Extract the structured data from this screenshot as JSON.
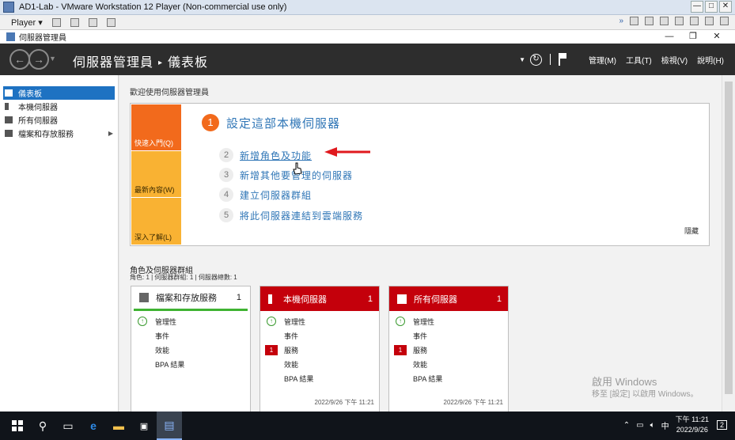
{
  "vmware": {
    "title": "AD1-Lab - VMware Workstation 12 Player (Non-commercial use only)",
    "player_menu": "Player ▾",
    "controls": [
      "—",
      "□",
      "✕"
    ]
  },
  "window": {
    "title": "伺服器管理員",
    "controls": [
      "—",
      "❐",
      "✕"
    ]
  },
  "header": {
    "breadcrumb_root": "伺服器管理員",
    "breadcrumb_sep": "▸",
    "breadcrumb_page": "儀表板",
    "menus": [
      "管理(M)",
      "工具(T)",
      "檢視(V)",
      "說明(H)"
    ]
  },
  "sidebar": {
    "items": [
      {
        "label": "儀表板",
        "active": true
      },
      {
        "label": "本機伺服器",
        "active": false
      },
      {
        "label": "所有伺服器",
        "active": false
      },
      {
        "label": "檔案和存放服務",
        "active": false,
        "has_arrow": true
      }
    ]
  },
  "welcome": {
    "heading": "歡迎使用伺服器管理員",
    "tiles": [
      "快速入門(Q)",
      "最新內容(W)",
      "深入了解(L)"
    ],
    "main_step": {
      "num": "1",
      "label": "設定這部本機伺服器"
    },
    "steps": [
      {
        "num": "2",
        "label": "新增角色及功能"
      },
      {
        "num": "3",
        "label": "新增其他要管理的伺服器"
      },
      {
        "num": "4",
        "label": "建立伺服器群組"
      },
      {
        "num": "5",
        "label": "將此伺服器連結到雲端服務"
      }
    ],
    "hide": "隱藏"
  },
  "roles": {
    "title": "角色及伺服器群組",
    "subtitle": "角色: 1 | 伺服器群組: 1 | 伺服器總數: 1",
    "cards": [
      {
        "name": "檔案和存放服務",
        "count": "1",
        "rows": [
          "管理性",
          "事件",
          "效能",
          "BPA 結果"
        ],
        "date": ""
      },
      {
        "name": "本機伺服器",
        "count": "1",
        "rows": [
          "管理性",
          "事件",
          "服務",
          "效能",
          "BPA 結果"
        ],
        "service_badge": "1",
        "date": "2022/9/26 下午 11:21"
      },
      {
        "name": "所有伺服器",
        "count": "1",
        "rows": [
          "管理性",
          "事件",
          "服務",
          "效能",
          "BPA 結果"
        ],
        "service_badge": "1",
        "date": "2022/9/26 下午 11:21"
      }
    ]
  },
  "watermark": {
    "line1": "啟用 Windows",
    "line2": "移至 [設定] 以啟用 Windows。"
  },
  "taskbar": {
    "ime": "中",
    "time": "下午 11:21",
    "date": "2022/9/26",
    "notif_count": "2"
  }
}
